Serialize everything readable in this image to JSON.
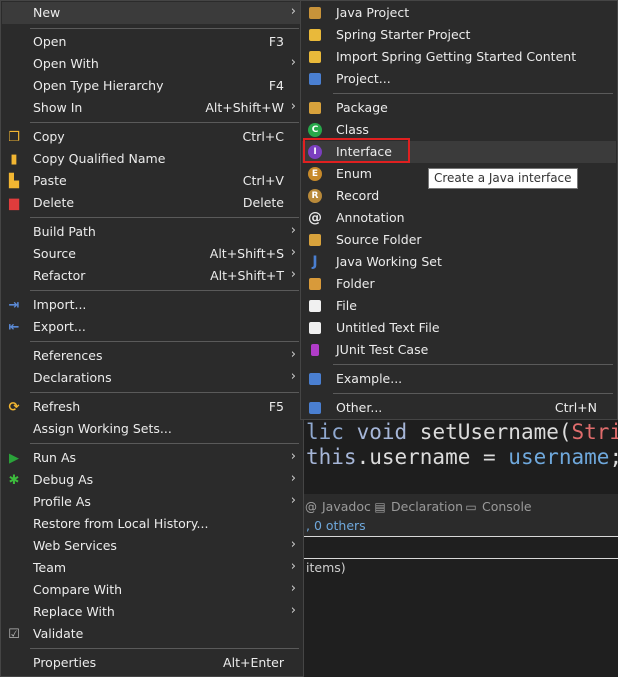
{
  "editor": {
    "line1": {
      "part1": "lic ",
      "part2": "void ",
      "part3": "setUsername(",
      "part4": "String"
    },
    "line2": {
      "part1": "this",
      "part2": ".username = ",
      "part3": "username",
      "part4": ";"
    }
  },
  "views": {
    "tabs": [
      {
        "label": "Javadoc",
        "icon": "at-icon"
      },
      {
        "label": "Declaration",
        "icon": "declaration-icon"
      },
      {
        "label": "Console",
        "icon": "console-icon"
      }
    ],
    "others_text": ", 0 others",
    "items_text": " items)"
  },
  "main_menu": {
    "new": {
      "label": "New"
    },
    "open": {
      "label": "Open",
      "accel": "F3"
    },
    "open_with": {
      "label": "Open With"
    },
    "open_type_hierarchy": {
      "label": "Open Type Hierarchy",
      "accel": "F4"
    },
    "show_in": {
      "label": "Show In",
      "accel": "Alt+Shift+W"
    },
    "copy": {
      "label": "Copy",
      "accel": "Ctrl+C"
    },
    "copy_qualified_name": {
      "label": "Copy Qualified Name"
    },
    "paste": {
      "label": "Paste",
      "accel": "Ctrl+V"
    },
    "delete": {
      "label": "Delete",
      "accel": "Delete"
    },
    "build_path": {
      "label": "Build Path"
    },
    "source": {
      "label": "Source",
      "accel": "Alt+Shift+S"
    },
    "refactor": {
      "label": "Refactor",
      "accel": "Alt+Shift+T"
    },
    "import": {
      "label": "Import..."
    },
    "export": {
      "label": "Export..."
    },
    "references": {
      "label": "References"
    },
    "declarations": {
      "label": "Declarations"
    },
    "refresh": {
      "label": "Refresh",
      "accel": "F5"
    },
    "assign_working_sets": {
      "label": "Assign Working Sets..."
    },
    "run_as": {
      "label": "Run As"
    },
    "debug_as": {
      "label": "Debug As"
    },
    "profile_as": {
      "label": "Profile As"
    },
    "restore_local_history": {
      "label": "Restore from Local History..."
    },
    "web_services": {
      "label": "Web Services"
    },
    "team": {
      "label": "Team"
    },
    "compare_with": {
      "label": "Compare With"
    },
    "replace_with": {
      "label": "Replace With"
    },
    "validate": {
      "label": "Validate"
    },
    "properties": {
      "label": "Properties",
      "accel": "Alt+Enter"
    }
  },
  "new_submenu": {
    "java_project": {
      "label": "Java Project"
    },
    "spring_starter_project": {
      "label": "Spring Starter Project"
    },
    "import_spring_content": {
      "label": "Import Spring Getting Started Content"
    },
    "project": {
      "label": "Project..."
    },
    "package": {
      "label": "Package"
    },
    "class": {
      "label": "Class"
    },
    "interface": {
      "label": "Interface"
    },
    "enum": {
      "label": "Enum"
    },
    "record": {
      "label": "Record"
    },
    "annotation": {
      "label": "Annotation"
    },
    "source_folder": {
      "label": "Source Folder"
    },
    "java_working_set": {
      "label": "Java Working Set"
    },
    "folder": {
      "label": "Folder"
    },
    "file": {
      "label": "File"
    },
    "untitled_text_file": {
      "label": "Untitled Text File"
    },
    "junit_test_case": {
      "label": "JUnit Test Case"
    },
    "example": {
      "label": "Example..."
    },
    "other": {
      "label": "Other...",
      "accel": "Ctrl+N"
    }
  },
  "tooltip": {
    "text": "Create a Java interface"
  },
  "colors": {
    "menu_bg": "#2b2b2b",
    "highlight": "#3b3b3b",
    "annotation_box": "#e02020",
    "keyword": "#8fa8cf",
    "type": "#e06c6c",
    "variable": "#6fa8dc"
  }
}
